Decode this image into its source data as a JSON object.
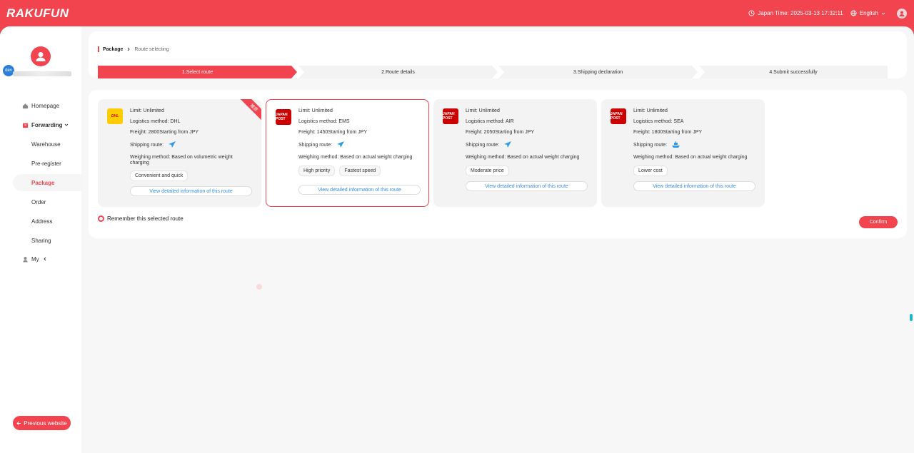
{
  "header": {
    "logo": "RAKUFUN",
    "japan_time": "Japan Time: 2025-03-13 17:32:11",
    "language": "English"
  },
  "sidebar": {
    "dev_badge": "dev",
    "items": [
      {
        "label": "Homepage",
        "icon": "home-icon"
      },
      {
        "label": "Forwarding",
        "icon": "box-icon"
      },
      {
        "label": "Warehouse"
      },
      {
        "label": "Pre-register"
      },
      {
        "label": "Package"
      },
      {
        "label": "Order"
      },
      {
        "label": "Address"
      },
      {
        "label": "Sharing"
      },
      {
        "label": "My",
        "icon": "user-icon"
      }
    ],
    "prev_button": "Previous website"
  },
  "breadcrumb": {
    "parent": "Package",
    "current": "Route selecting"
  },
  "steps": [
    "1.Select route",
    "2.Route details",
    "3.Shipping declaration",
    "4.Submit successfully"
  ],
  "cards": [
    {
      "logo": "DHL",
      "limit": "Limit:  Unlimited",
      "method": "Logistics method:  DHL",
      "freight": "Freight:  2800Starting from JPY",
      "route_label": "Shipping route:",
      "route_icon": "airplane-icon",
      "weigh": "Weighing method:  Based on volumetric weight charging",
      "tags": [
        "Convenient and quick"
      ],
      "link": "View detailed information of this route",
      "ribbon": "推荐"
    },
    {
      "logo": "JAPAN POST",
      "limit": "Limit:  Unlimited",
      "method": "Logistics method:  EMS",
      "freight": "Freight:  1450Starting from JPY",
      "route_label": "Shipping route:",
      "route_icon": "airplane-icon",
      "weigh": "Weighing method:  Based on actual weight charging",
      "tags": [
        "High priority",
        "Fastest speed"
      ],
      "link": "View detailed information of this route"
    },
    {
      "logo": "JAPAN POST",
      "limit": "Limit:  Unlimited",
      "method": "Logistics method:  AIR",
      "freight": "Freight:  2050Starting from JPY",
      "route_label": "Shipping route:",
      "route_icon": "airplane-icon",
      "weigh": "Weighing method:  Based on actual weight charging",
      "tags": [
        "Moderate price"
      ],
      "link": "View detailed information of this route"
    },
    {
      "logo": "JAPAN POST",
      "limit": "Limit:  Unlimited",
      "method": "Logistics method:  SEA",
      "freight": "Freight:  1800Starting from JPY",
      "route_label": "Shipping route:",
      "route_icon": "ship-icon",
      "weigh": "Weighing method:  Based on actual weight charging",
      "tags": [
        "Lower cost"
      ],
      "link": "View detailed information of this route"
    }
  ],
  "remember_label": "Remember this selected route",
  "confirm_label": "Confirm",
  "colors": {
    "brand": "#f2444f",
    "link": "#3b8de0"
  }
}
